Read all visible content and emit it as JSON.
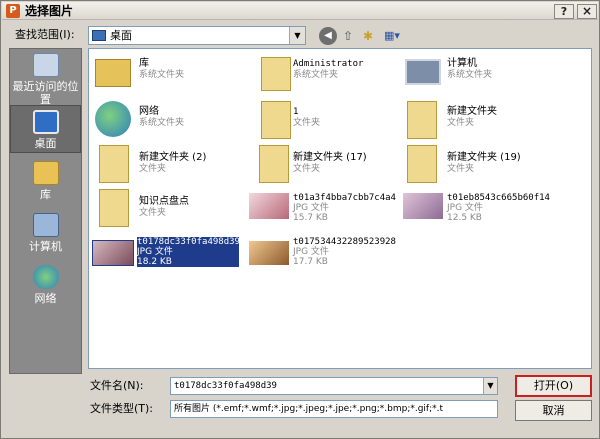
{
  "window": {
    "title": "选择图片",
    "app_icon": "P",
    "help_button": "?",
    "close_button": "×"
  },
  "lookin": {
    "label": "查找范围(I):",
    "value": "桌面"
  },
  "toolbar": {
    "back": "◀",
    "up": "⇧",
    "new_folder": "✱",
    "views": "▦▾"
  },
  "places": [
    {
      "label": "最近访问的位置",
      "icon": "recent-icon"
    },
    {
      "label": "桌面",
      "icon": "desktop-icon"
    },
    {
      "label": "库",
      "icon": "library-icon"
    },
    {
      "label": "计算机",
      "icon": "computer-icon"
    },
    {
      "label": "网络",
      "icon": "network-icon"
    }
  ],
  "files": [
    {
      "name": "库",
      "sub": "系统文件夹"
    },
    {
      "name": "Administrator",
      "sub": "系统文件夹"
    },
    {
      "name": "计算机",
      "sub": "系统文件夹"
    },
    {
      "name": "网络",
      "sub": "系统文件夹"
    },
    {
      "name": "1",
      "sub": "文件夹"
    },
    {
      "name": "新建文件夹",
      "sub": "文件夹"
    },
    {
      "name": "新建文件夹 (2)",
      "sub": "文件夹"
    },
    {
      "name": "新建文件夹 (17)",
      "sub": "文件夹"
    },
    {
      "name": "新建文件夹 (19)",
      "sub": "文件夹"
    },
    {
      "name": "知识点盘点",
      "sub": "文件夹"
    },
    {
      "name": "t01a3f4bba7cbb7c4a4",
      "type": "JPG 文件",
      "size": "15.7 KB"
    },
    {
      "name": "t01eb8543c665b60f14",
      "type": "JPG 文件",
      "size": "12.5 KB"
    },
    {
      "name": "t0178dc33f0fa498d39",
      "type": "JPG 文件",
      "size": "18.2 KB"
    },
    {
      "name": "t017534432289523928",
      "type": "JPG 文件",
      "size": "17.7 KB"
    }
  ],
  "filename": {
    "label": "文件名(N):",
    "value": "t0178dc33f0fa498d39"
  },
  "filetype": {
    "label": "文件类型(T):",
    "value": "所有图片 (*.emf;*.wmf;*.jpg;*.jpeg;*.jpe;*.png;*.bmp;*.gif;*.t"
  },
  "buttons": {
    "open": "打开(O)",
    "cancel": "取消"
  },
  "colors": {
    "selection": "#1f3c8c",
    "focus_border": "#cc2020",
    "places_bg": "#8a8a8a"
  }
}
